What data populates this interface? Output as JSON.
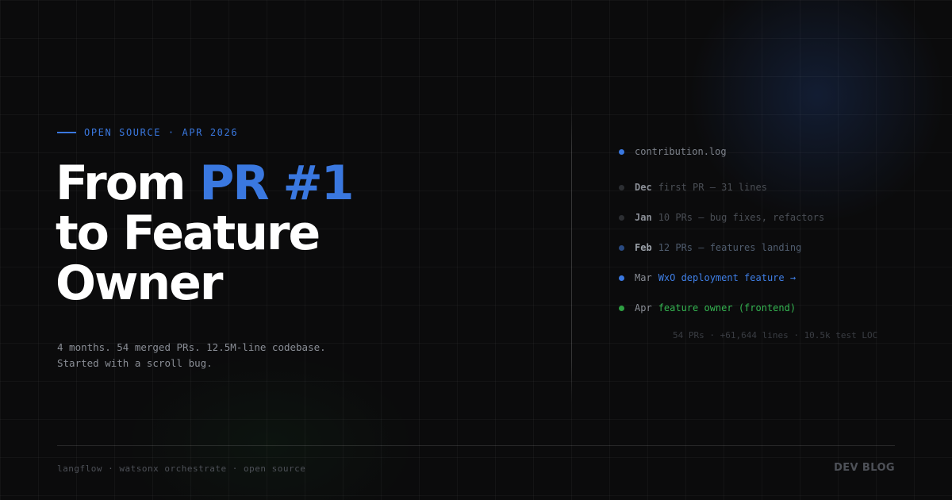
{
  "eyebrow": {
    "text": "OPEN SOURCE · APR 2026"
  },
  "headline": {
    "line1_pre": "From ",
    "line1_accent": "PR #1",
    "line2": "to Feature",
    "line3": "Owner"
  },
  "subtitle": {
    "line1": "4 months. 54 merged PRs. 12.5M-line codebase.",
    "line2": "Started with a scroll bug."
  },
  "log": {
    "title": "contribution.log",
    "entries": [
      {
        "month": "Dec",
        "text": "first PR — 31 lines"
      },
      {
        "month": "Jan",
        "text": "10 PRs — bug fixes, refactors"
      },
      {
        "month": "Feb",
        "text": "12 PRs — features landing"
      },
      {
        "month": "Mar",
        "text": "WxO deployment feature →"
      },
      {
        "month": "Apr",
        "text": "feature owner (frontend)"
      }
    ],
    "stats": "54 PRs · +61,644 lines · 10.5k test LOC"
  },
  "footer": {
    "tags": "langflow · watsonx orchestrate · open source",
    "brand": "DEV BLOG"
  },
  "colors": {
    "accent_blue": "#3a78e0",
    "accent_green": "#2ea043",
    "background": "#0b0b0c"
  }
}
